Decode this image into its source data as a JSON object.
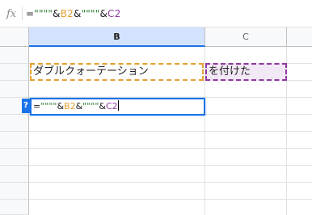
{
  "formula_bar": {
    "fx_label": "fx",
    "tokens": [
      {
        "text": "=",
        "color": "#202124"
      },
      {
        "text": "\"\"\"\"",
        "color": "#2e7d32"
      },
      {
        "text": "&",
        "color": "#202124"
      },
      {
        "text": "B2",
        "color": "#e69f32"
      },
      {
        "text": "&",
        "color": "#202124"
      },
      {
        "text": "\"\"\"\"",
        "color": "#2e7d32"
      },
      {
        "text": "&",
        "color": "#202124"
      },
      {
        "text": "C2",
        "color": "#8e3aa0"
      }
    ]
  },
  "columns": [
    {
      "label": "B",
      "selected": true
    },
    {
      "label": "C",
      "selected": false
    }
  ],
  "cells": {
    "b2": "ダブルクォーテーション",
    "c2": "を付けた"
  },
  "editor": {
    "help_badge": "?"
  },
  "colors": {
    "selection_blue": "#1a73e8",
    "b2_ref": "#e69f32",
    "c2_ref": "#8e3aa0",
    "string_green": "#2e7d32"
  }
}
